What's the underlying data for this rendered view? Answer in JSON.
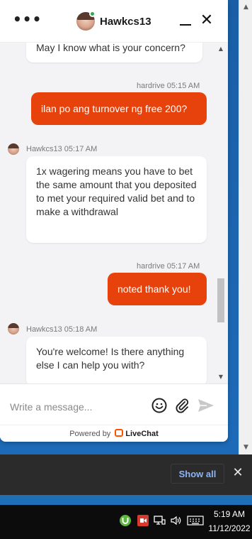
{
  "header": {
    "agent_name": "Hawkcs13",
    "menu_icon": "more-dots-icon",
    "minimize_icon": "minimize-icon",
    "close_icon": "close-icon",
    "online_color": "#2fa84f"
  },
  "messages": [
    {
      "from": "agent",
      "text": "May I know what is your concern?"
    },
    {
      "from": "user",
      "meta": "hardrive 05:15 AM",
      "text": "ilan po ang turnover ng free 200?"
    },
    {
      "from": "agent",
      "meta": "Hawkcs13 05:17 AM",
      "text": "1x wagering means you have to bet the same amount that you deposited to met your required valid bet and to make a withdrawal"
    },
    {
      "from": "user",
      "meta": "hardrive 05:17 AM",
      "text": "noted thank you!"
    },
    {
      "from": "agent",
      "meta": "Hawkcs13 05:18 AM",
      "text": "You're welcome! Is there anything else I can help you with?"
    }
  ],
  "composer": {
    "placeholder": "Write a message...",
    "emoji_icon": "emoji-icon",
    "attach_icon": "paperclip-icon",
    "send_icon": "send-icon"
  },
  "footer": {
    "powered_by": "Powered by",
    "brand": "LiveChat"
  },
  "download_bar": {
    "show_all_label": "Show all",
    "close_icon": "close-icon"
  },
  "taskbar": {
    "time": "5:19 AM",
    "date": "11/12/2022"
  },
  "colors": {
    "user_bubble": "#e8420c",
    "show_all_text": "#8ab4f8",
    "livechat_brand": "#ff5100"
  }
}
